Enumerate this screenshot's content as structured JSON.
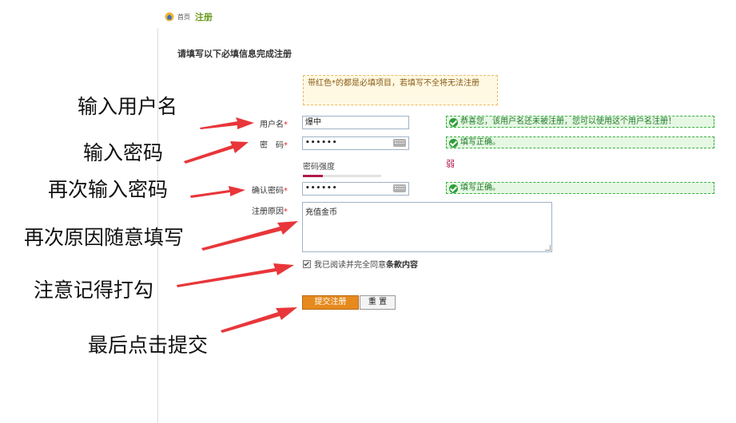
{
  "breadcrumb": {
    "home": "首页",
    "current": "注册"
  },
  "form": {
    "heading": "请填写以下必填信息完成注册",
    "notice": "带红色*的都是必填项目，若填写不全将无法注册",
    "required_mark": "*",
    "username": {
      "label": "用户名",
      "value": "爆中",
      "tip": "恭喜您，该用户名还未被注册，您可以使用这个用户名注册！"
    },
    "password": {
      "label": "密　码",
      "value": "••••••",
      "tip": "填写正确。"
    },
    "strength": {
      "label": "密码强度",
      "level": 0.25,
      "text": "弱"
    },
    "confirm_password": {
      "label": "确认密码",
      "value": "••••••",
      "tip": "填写正确。"
    },
    "reason": {
      "label": "注册原因",
      "value": "充值金币"
    },
    "agree": {
      "checked": true,
      "text": "我已阅读并完全同意",
      "terms": "条款内容"
    },
    "submit_label": "提交注册",
    "reset_label": "重 置"
  },
  "annotations": [
    "输入用户名",
    "输入密码",
    "再次输入密码",
    "再次原因随意填写",
    "注意记得打勾",
    "最后点击提交"
  ],
  "colors": {
    "arrow": "#e8363a",
    "accent": "#e68a1e",
    "success": "#2e9e3a",
    "weak": "#b01a4a"
  }
}
